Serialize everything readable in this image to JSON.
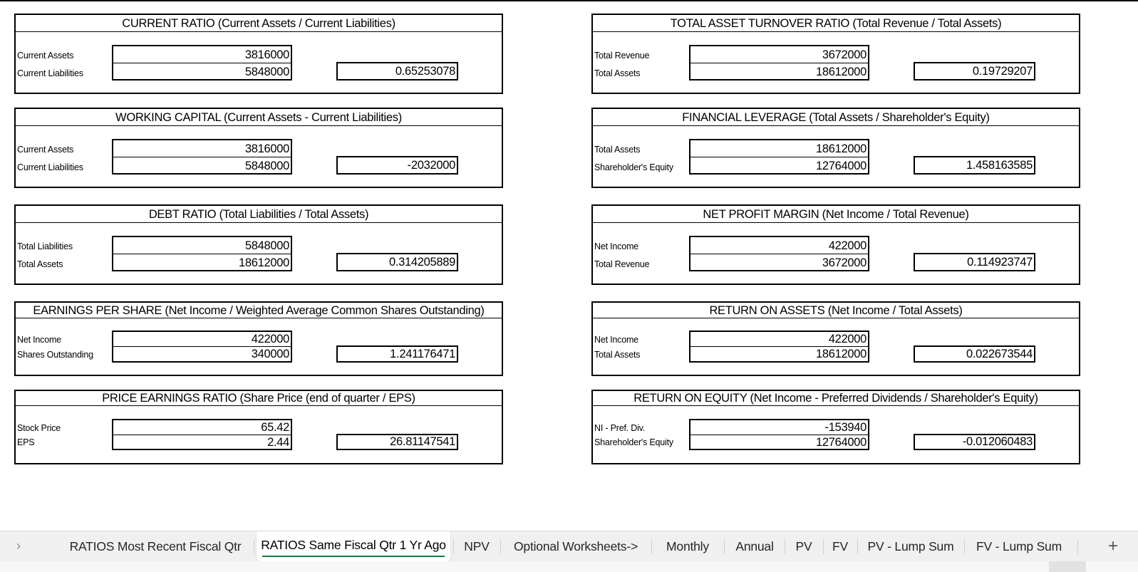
{
  "sheet": {
    "left_column": [
      {
        "title": "CURRENT RATIO (Current Assets / Current Liabilities)",
        "labels": [
          "Current Assets",
          "Current Liabilities"
        ],
        "inputs": [
          "3816000",
          "5848000"
        ],
        "result": "0.65253078"
      },
      {
        "title": "WORKING CAPITAL (Current Assets - Current Liabilities)",
        "labels": [
          "Current Assets",
          "Current Liabilities"
        ],
        "inputs": [
          "3816000",
          "5848000"
        ],
        "result": "-2032000"
      },
      {
        "title": "DEBT RATIO (Total Liabilities / Total Assets)",
        "labels": [
          "Total Liabilities",
          "Total Assets"
        ],
        "inputs": [
          "5848000",
          "18612000"
        ],
        "result": "0.314205889"
      },
      {
        "title": "EARNINGS PER SHARE (Net Income / Weighted Average Common Shares Outstanding)",
        "labels": [
          "Net Income",
          "Shares Outstanding"
        ],
        "inputs": [
          "422000",
          "340000"
        ],
        "result": "1.241176471"
      },
      {
        "title": "PRICE EARNINGS RATIO (Share Price (end of quarter / EPS)",
        "labels": [
          "Stock Price",
          "EPS"
        ],
        "inputs": [
          "65.42",
          "2.44"
        ],
        "result": "26.81147541"
      }
    ],
    "right_column": [
      {
        "title": "TOTAL ASSET TURNOVER RATIO (Total Revenue / Total Assets)",
        "labels": [
          "Total Revenue",
          "Total Assets"
        ],
        "inputs": [
          "3672000",
          "18612000"
        ],
        "result": "0.19729207"
      },
      {
        "title": "FINANCIAL LEVERAGE (Total Assets / Shareholder's Equity)",
        "labels": [
          "Total Assets",
          "Shareholder's Equity"
        ],
        "inputs": [
          "18612000",
          "12764000"
        ],
        "result": "1.458163585"
      },
      {
        "title": "NET PROFIT MARGIN (Net Income / Total Revenue)",
        "labels": [
          "Net Income",
          "Total Revenue"
        ],
        "inputs": [
          "422000",
          "3672000"
        ],
        "result": "0.114923747"
      },
      {
        "title": "RETURN ON ASSETS (Net Income / Total Assets)",
        "labels": [
          "Net Income",
          "Total Assets"
        ],
        "inputs": [
          "422000",
          "18612000"
        ],
        "result": "0.022673544"
      },
      {
        "title": "RETURN ON EQUITY (Net Income - Preferred Dividends / Shareholder's Equity)",
        "labels": [
          "NI - Pref. Div.",
          "Shareholder's Equity"
        ],
        "inputs": [
          "-153940",
          "12764000"
        ],
        "result": "-0.012060483"
      }
    ]
  },
  "tabbar": {
    "nav_icon": "chevron-right-icon",
    "nav_glyph": "›",
    "tabs": [
      {
        "label": "RATIOS Most Recent Fiscal Qtr",
        "active": false
      },
      {
        "label": "RATIOS Same Fiscal Qtr 1 Yr Ago",
        "active": true
      },
      {
        "label": "NPV",
        "active": false
      },
      {
        "label": "Optional Worksheets->",
        "active": false
      },
      {
        "label": "Monthly",
        "active": false
      },
      {
        "label": "Annual",
        "active": false
      },
      {
        "label": "PV",
        "active": false
      },
      {
        "label": "FV",
        "active": false
      },
      {
        "label": "PV - Lump Sum",
        "active": false
      },
      {
        "label": "FV - Lump Sum",
        "active": false
      }
    ],
    "add_icon": "plus-icon",
    "add_glyph": "+"
  },
  "colors": {
    "active_tab_underline": "#107c41",
    "tabbar_background": "#f0f0f0"
  }
}
